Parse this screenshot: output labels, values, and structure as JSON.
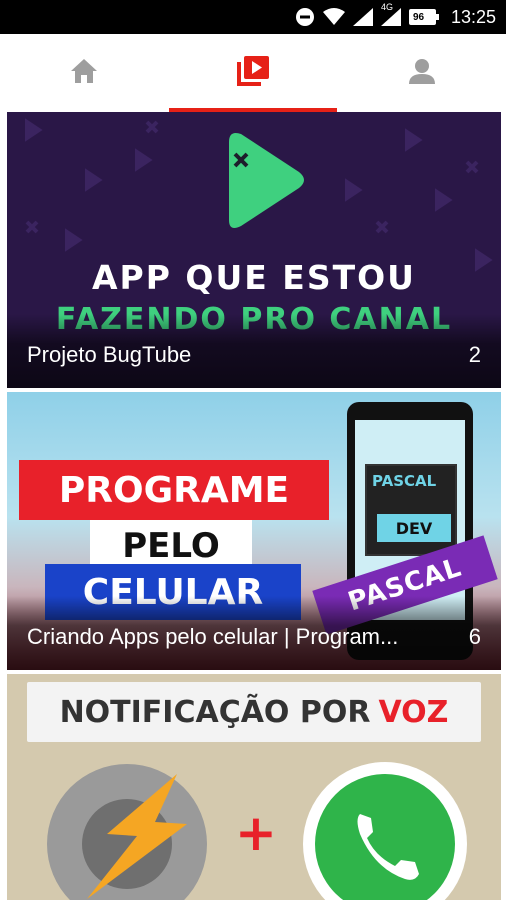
{
  "status_bar": {
    "icons": [
      "do-not-disturb-icon",
      "wifi-icon",
      "signal-icon",
      "signal-4g-icon",
      "battery-icon"
    ],
    "network_label": "4G",
    "battery_level": "96",
    "time": "13:25"
  },
  "tabs": [
    {
      "icon": "home-icon",
      "active": false
    },
    {
      "icon": "playlist-play-icon",
      "active": true
    },
    {
      "icon": "person-icon",
      "active": false
    }
  ],
  "colors": {
    "accent": "#e62117",
    "card1_bg": "#2a1747",
    "green": "#3fd07f"
  },
  "playlists": [
    {
      "thumbnail": {
        "line1": "APP QUE ESTOU",
        "line2": "FAZENDO PRO CANAL"
      },
      "title": "Projeto BugTube",
      "count": "2"
    },
    {
      "thumbnail": {
        "line1": "PROGRAME",
        "line2": "PELO",
        "line3": "CELULAR",
        "phone_label": "PASCAL",
        "phone_button": "DEV",
        "ribbon": "PASCAL"
      },
      "title": "Criando Apps pelo celular | Program...",
      "count": "6"
    },
    {
      "thumbnail": {
        "headline": "NOTIFICAÇÃO POR",
        "headline_accent": "VOZ",
        "plus": "+"
      },
      "title": "",
      "count": ""
    }
  ]
}
